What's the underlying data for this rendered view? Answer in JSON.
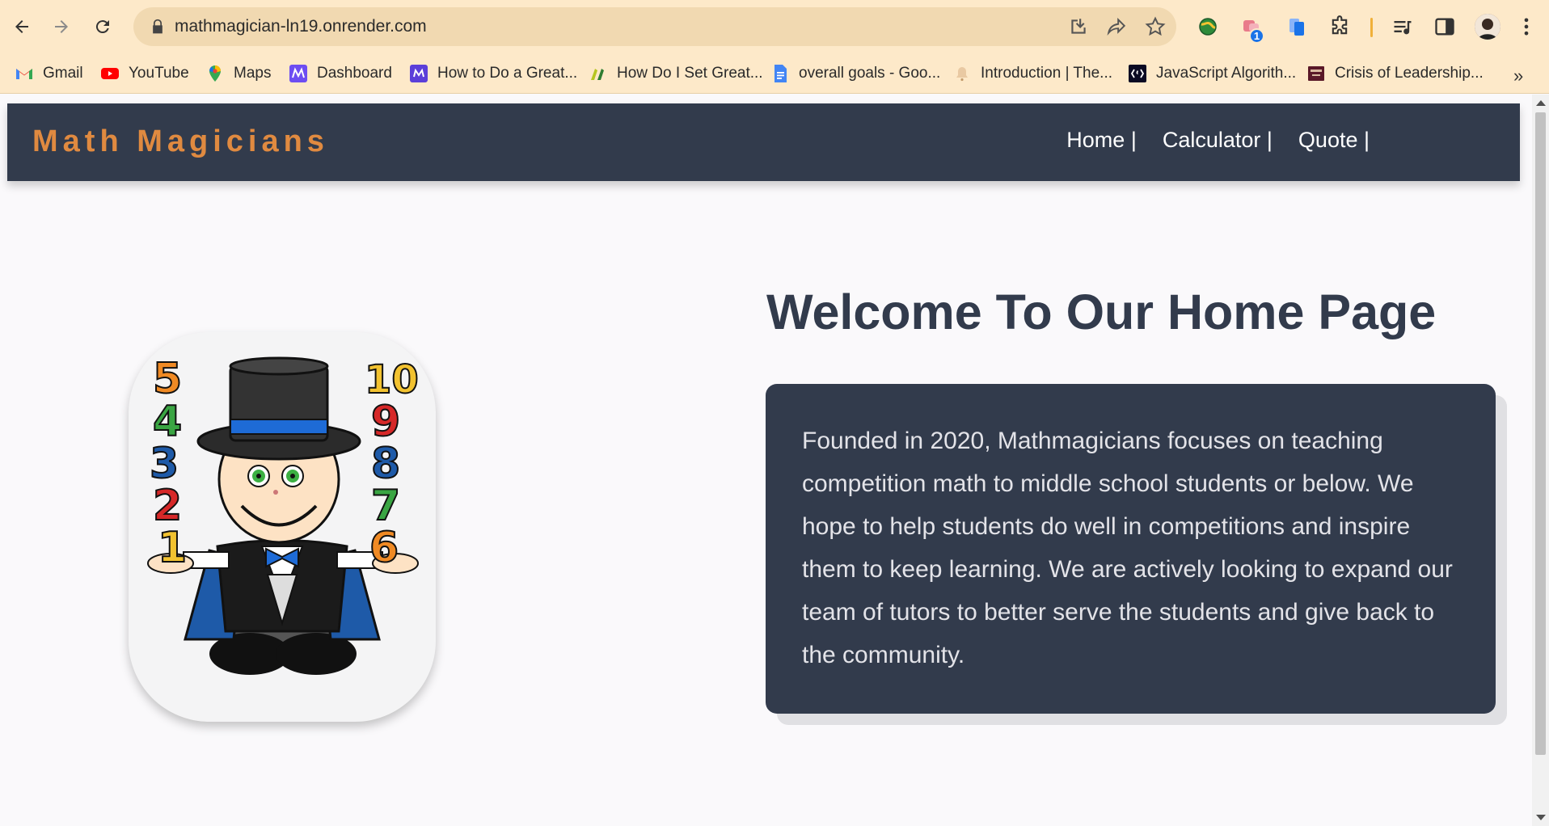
{
  "browser": {
    "url": "mathmagician-ln19.onrender.com",
    "extension_badge": "1",
    "bookmarks": [
      {
        "label": "Gmail",
        "icon": "gmail-icon"
      },
      {
        "label": "YouTube",
        "icon": "youtube-icon"
      },
      {
        "label": "Maps",
        "icon": "maps-icon"
      },
      {
        "label": "Dashboard",
        "icon": "dashboard-icon"
      },
      {
        "label": "How to Do a Great...",
        "icon": "purple-logo-icon"
      },
      {
        "label": "How Do I Set Great...",
        "icon": "green-logo-icon"
      },
      {
        "label": "overall goals - Goo...",
        "icon": "google-docs-icon"
      },
      {
        "label": "Introduction | The...",
        "icon": "bell-logo-icon"
      },
      {
        "label": "JavaScript Algorith...",
        "icon": "freecodecamp-icon"
      },
      {
        "label": "Crisis of Leadership...",
        "icon": "book-icon"
      }
    ],
    "more_bookmarks": "»"
  },
  "header": {
    "brand": "Math Magicians",
    "nav": [
      "Home |",
      "Calculator |",
      "Quote |"
    ]
  },
  "main": {
    "title": "Welcome To Our Home Page",
    "description": "Founded in 2020, Mathmagicians focuses on teaching competition math to middle school students or below. We hope to help students do well in competitions and inspire them to keep learning. We are actively looking to expand our team of tutors to better serve the students and give back to the community.",
    "hero_numbers_left": [
      "5",
      "4",
      "3",
      "2",
      "1"
    ],
    "hero_numbers_right": [
      "10",
      "9",
      "8",
      "7",
      "6"
    ]
  },
  "colors": {
    "header_bg": "#323b4c",
    "brand": "#e08a40",
    "chrome_bg": "#fde9c9",
    "page_bg": "#faf9fb"
  }
}
